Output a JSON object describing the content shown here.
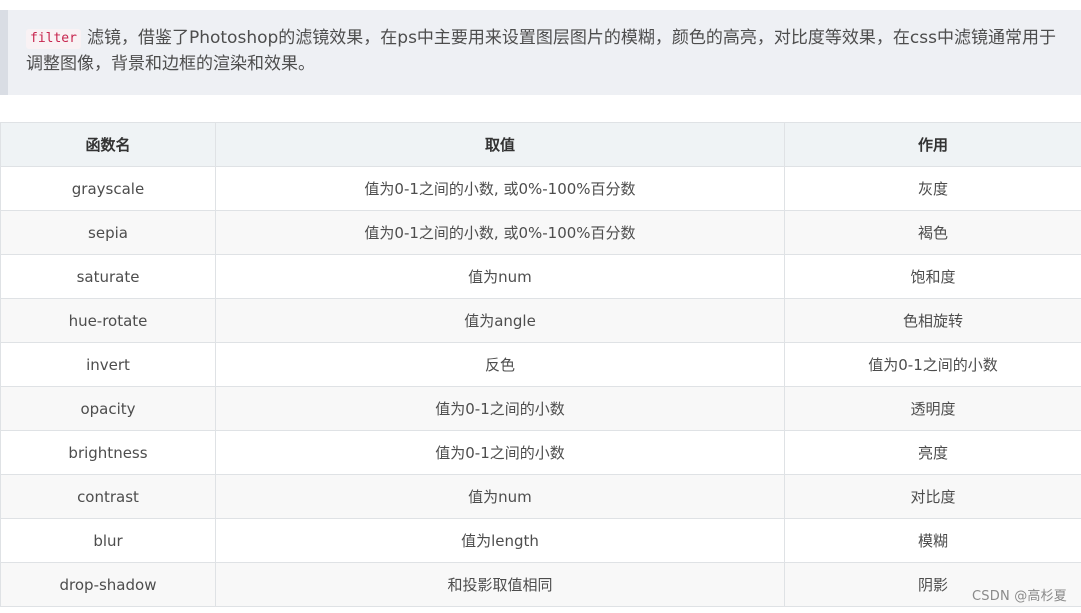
{
  "intro": {
    "code": "filter",
    "text": "滤镜，借鉴了Photoshop的滤镜效果，在ps中主要用来设置图层图片的模糊，颜色的高亮，对比度等效果，在css中滤镜通常用于调整图像，背景和边框的渲染和效果。"
  },
  "table": {
    "headers": [
      "函数名",
      "取值",
      "作用"
    ],
    "rows": [
      [
        "grayscale",
        "值为0-1之间的小数, 或0%-100%百分数",
        "灰度"
      ],
      [
        "sepia",
        "值为0-1之间的小数, 或0%-100%百分数",
        "褐色"
      ],
      [
        "saturate",
        "值为num",
        "饱和度"
      ],
      [
        "hue-rotate",
        "值为angle",
        "色相旋转"
      ],
      [
        "invert",
        "反色",
        "值为0-1之间的小数"
      ],
      [
        "opacity",
        "值为0-1之间的小数",
        "透明度"
      ],
      [
        "brightness",
        "值为0-1之间的小数",
        "亮度"
      ],
      [
        "contrast",
        "值为num",
        "对比度"
      ],
      [
        "blur",
        "值为length",
        "模糊"
      ],
      [
        "drop-shadow",
        "和投影取值相同",
        "阴影"
      ]
    ]
  },
  "watermark": "CSDN @高杉夏"
}
